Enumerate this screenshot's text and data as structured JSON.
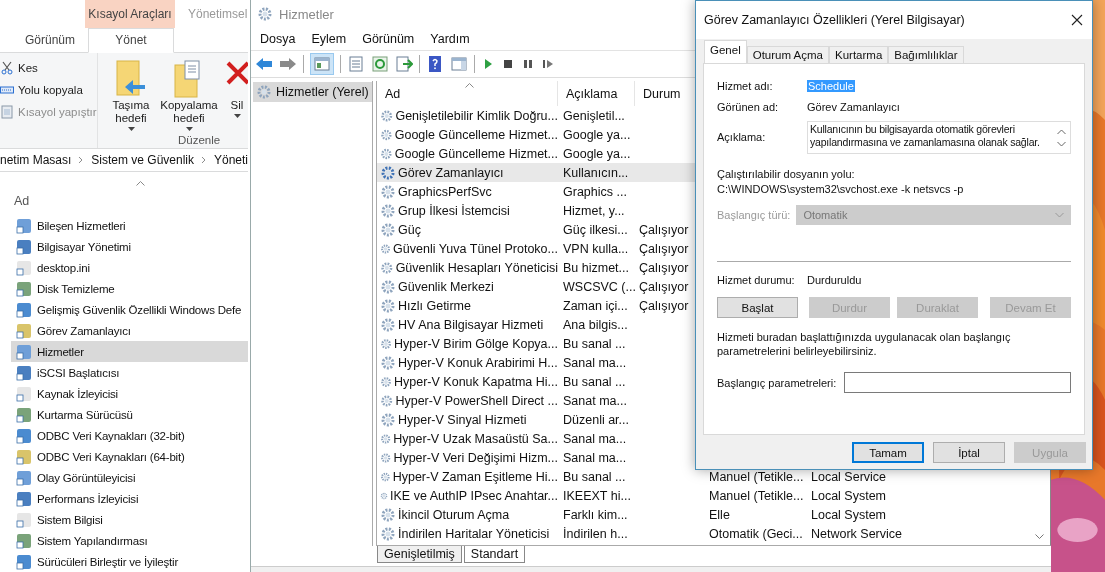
{
  "explorer": {
    "context_tab": "Kısayol Araçları",
    "context_tab_next": "Yönetimsel",
    "ribbon_tabs": [
      {
        "label": "Görünüm",
        "selected": false
      },
      {
        "label": "Yönet",
        "selected": true
      }
    ],
    "clipboard_items": [
      {
        "label": "Kes",
        "disabled": false
      },
      {
        "label": "Yolu kopyala",
        "disabled": false
      },
      {
        "label": "Kısayol yapıştır",
        "disabled": true
      }
    ],
    "ribbon_buttons": [
      {
        "kind": "move",
        "lines": [
          "Taşıma",
          "hedefi"
        ]
      },
      {
        "kind": "copy",
        "lines": [
          "Kopyalama",
          "hedefi"
        ]
      },
      {
        "kind": "delete",
        "lines": [
          "Sil"
        ]
      }
    ],
    "group_label": "Düzenle",
    "breadcrumb": [
      "netim Masası",
      "Sistem ve Güvenlik",
      "Yöneti"
    ],
    "column": "Ad",
    "items": [
      {
        "label": "Bileşen Hizmetleri",
        "selected": false
      },
      {
        "label": "Bilgisayar Yönetimi",
        "selected": false
      },
      {
        "label": "desktop.ini",
        "selected": false
      },
      {
        "label": "Disk Temizleme",
        "selected": false
      },
      {
        "label": "Gelişmiş Güvenlik Özellikli Windows Defe",
        "selected": false
      },
      {
        "label": "Görev Zamanlayıcı",
        "selected": false
      },
      {
        "label": "Hizmetler",
        "selected": true
      },
      {
        "label": "iSCSI Başlatıcısı",
        "selected": false
      },
      {
        "label": "Kaynak İzleyicisi",
        "selected": false
      },
      {
        "label": "Kurtarma Sürücüsü",
        "selected": false
      },
      {
        "label": "ODBC Veri Kaynakları (32-bit)",
        "selected": false
      },
      {
        "label": "ODBC Veri Kaynakları (64-bit)",
        "selected": false
      },
      {
        "label": "Olay Görüntüleyicisi",
        "selected": false
      },
      {
        "label": "Performans İzleyicisi",
        "selected": false
      },
      {
        "label": "Sistem Bilgisi",
        "selected": false
      },
      {
        "label": "Sistem Yapılandırması",
        "selected": false
      },
      {
        "label": "Sürücüleri Birleştir ve İyileştir",
        "selected": false
      }
    ]
  },
  "services": {
    "title": "Hizmetler",
    "menu": [
      "Dosya",
      "Eylem",
      "Görünüm",
      "Yardım"
    ],
    "tree_item": {
      "label": "Hizmetler (Yerel)",
      "selected": true
    },
    "columns": [
      "Ad",
      "Açıklama",
      "Durum"
    ],
    "rows": [
      {
        "name": "Genişletilebilir Kimlik Doğru...",
        "description": "Genişletil...",
        "selected": false
      },
      {
        "name": "Google Güncelleme Hizmet...",
        "description": "Google ya...",
        "selected": false
      },
      {
        "name": "Google Güncelleme Hizmet...",
        "description": "Google ya...",
        "selected": false
      },
      {
        "name": "Görev Zamanlayıcı",
        "description": "Kullanıcın...",
        "selected": true
      },
      {
        "name": "GraphicsPerfSvc",
        "description": "Graphics ...",
        "selected": false
      },
      {
        "name": "Grup İlkesi İstemcisi",
        "description": "Hizmet, y...",
        "selected": false
      },
      {
        "name": "Güç",
        "description": "Güç ilkesi...",
        "status": "Çalışıyor",
        "selected": false
      },
      {
        "name": "Güvenli Yuva Tünel Protoko...",
        "description": "VPN kulla...",
        "status": "Çalışıyor",
        "selected": false
      },
      {
        "name": "Güvenlik Hesapları Yöneticisi",
        "description": "Bu hizmet...",
        "status": "Çalışıyor",
        "selected": false
      },
      {
        "name": "Güvenlik Merkezi",
        "description": "WSCSVC (...",
        "status": "Çalışıyor",
        "selected": false
      },
      {
        "name": "Hızlı Getirme",
        "description": "Zaman içi...",
        "status": "Çalışıyor",
        "selected": false
      },
      {
        "name": "HV Ana Bilgisayar Hizmeti",
        "description": "Ana bilgis...",
        "selected": false
      },
      {
        "name": "Hyper-V Birim Gölge Kopya...",
        "description": "Bu sanal ...",
        "selected": false
      },
      {
        "name": "Hyper-V Konuk Arabirimi H...",
        "description": "Sanal ma...",
        "selected": false
      },
      {
        "name": "Hyper-V Konuk Kapatma Hi...",
        "description": "Bu sanal ...",
        "selected": false
      },
      {
        "name": "Hyper-V PowerShell Direct ...",
        "description": "Sanat ma...",
        "selected": false
      },
      {
        "name": "Hyper-V Sinyal Hizmeti",
        "description": "Düzenli ar...",
        "selected": false
      },
      {
        "name": "Hyper-V Uzak Masaüstü Sa...",
        "description": "Sanal ma...",
        "selected": false
      },
      {
        "name": "Hyper-V Veri Değişimi Hizm...",
        "description": "Sanal ma...",
        "selected": false
      },
      {
        "name": "Hyper-V Zaman Eşitleme Hi...",
        "description": "Bu sanal ...",
        "startup": "Manuel (Tetikle...",
        "logon": "Local Service",
        "selected": false
      },
      {
        "name": "IKE ve AuthIP IPsec Anahtar...",
        "description": "IKEEXT hi...",
        "startup": "Manuel (Tetikle...",
        "logon": "Local System",
        "selected": false
      },
      {
        "name": "İkincil Oturum Açma",
        "description": "Farklı kim...",
        "startup": "Elle",
        "logon": "Local System",
        "selected": false
      },
      {
        "name": "İndirilen Haritalar Yöneticisi",
        "description": "İndirilen h...",
        "startup": "Otomatik (Geci...",
        "logon": "Network Service",
        "selected": false
      }
    ],
    "view_tabs": [
      {
        "label": "Genişletilmiş",
        "selected": false
      },
      {
        "label": "Standart",
        "selected": true
      }
    ]
  },
  "dialog": {
    "title": "Görev Zamanlayıcı Özellikleri (Yerel Bilgisayar)",
    "tabs": [
      {
        "label": "Genel",
        "selected": true
      },
      {
        "label": "Oturum Açma",
        "selected": false
      },
      {
        "label": "Kurtarma",
        "selected": false
      },
      {
        "label": "Bağımlılıklar",
        "selected": false
      }
    ],
    "service_name_label": "Hizmet adı:",
    "service_name": "Schedule",
    "display_name_label": "Görünen ad:",
    "display_name": "Görev Zamanlayıcı",
    "description_label": "Açıklama:",
    "description": "Kullanıcının bu bilgisayarda otomatik görevleri yapılandırmasına ve zamanlamasına olanak sağlar.",
    "path_label": "Çalıştırılabilir dosyanın yolu:",
    "path": "C:\\WINDOWS\\system32\\svchost.exe -k netsvcs -p",
    "startup_label": "Başlangıç türü:",
    "startup_type": "Otomatik",
    "startup_disabled": true,
    "status_label": "Hizmet durumu:",
    "status": "Durduruldu",
    "control_buttons": [
      {
        "label": "Başlat",
        "disabled": false
      },
      {
        "label": "Durdur",
        "disabled": true
      },
      {
        "label": "Duraklat",
        "disabled": true
      },
      {
        "label": "Devam Et",
        "disabled": true
      }
    ],
    "help": "Hizmeti buradan başlattığınızda uygulanacak olan başlangıç parametrelerini belirleyebilirsiniz.",
    "params_label": "Başlangıç parametreleri:",
    "footer_buttons": [
      {
        "label": "Tamam",
        "default": true,
        "disabled": false
      },
      {
        "label": "İptal",
        "default": false,
        "disabled": false
      },
      {
        "label": "Uygula",
        "default": false,
        "disabled": true
      }
    ]
  }
}
